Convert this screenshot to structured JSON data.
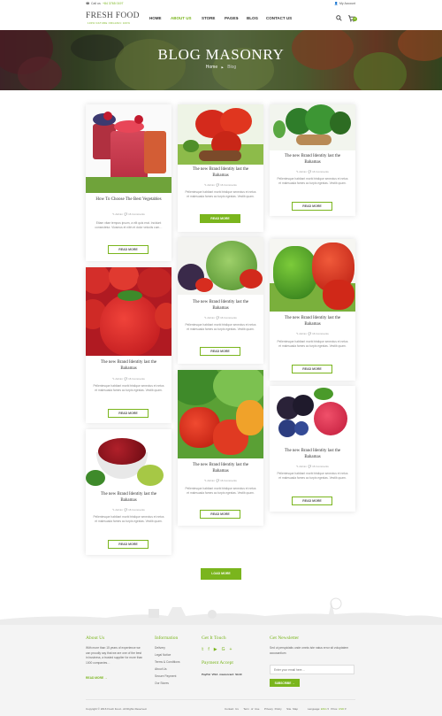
{
  "topbar": {
    "call": "Call us",
    "phone": "+84 3765 0197",
    "account": "My Account"
  },
  "header": {
    "logo": "FRESH FOOD",
    "tagline": "100% NATURE ORGANIC 100%",
    "nav": [
      "HOME",
      "ABOUT US",
      "STORE",
      "PAGES",
      "BLOG",
      "CONTACT US"
    ],
    "cart_count": "0"
  },
  "hero": {
    "title": "BLOG MASONRY",
    "crumb_home": "Home",
    "crumb_sep": "▶",
    "crumb_current": "Blog"
  },
  "cards": [
    {
      "title": "How To Choose The Best Vegetables",
      "author": "Admin",
      "comments": "16 Comments",
      "excerpt": "Etiam vitae tempus ipsum, a elit quis erat. Incidunt consectetur. Vivamus et nibh et dolor velociis cum…",
      "btn": "READ MORE"
    },
    {
      "title": "The new Brand Identity last the Bahamas",
      "author": "Admin",
      "comments": "16 Comments",
      "excerpt": "Pellentesque habitant morbi tristique senectus et netus et malesuada fames ac turpis egestas. Vestib quam.",
      "btn": "READ MORE"
    },
    {
      "title": "The new Brand Identity last the Bahamas",
      "author": "Admin",
      "comments": "16 Comments",
      "excerpt": "Pellentesque habitant morbi tristique senectus et netus et malesuada fames ac turpis egestas. Vestib quam.",
      "btn": "READ MORE"
    },
    {
      "title": "The new Brand Identity last the Bahamas",
      "author": "Admin",
      "comments": "16 Comments",
      "excerpt": "Pellentesque habitant morbi tristique senectus et netus et malesuada fames ac turpis egestas. Vestib quam.",
      "btn": "READ MORE"
    },
    {
      "title": "The new Brand Identity last the Bahamas",
      "author": "Admin",
      "comments": "16 Comments",
      "excerpt": "Pellentesque habitant morbi tristique senectus et netus et malesuada fames ac turpis egestas. Vestib quam.",
      "btn": "READ MORE"
    },
    {
      "title": "The new Brand Identity last the Bahamas",
      "author": "Admin",
      "comments": "16 Comments",
      "excerpt": "Pellentesque habitant morbi tristique senectus et netus et malesuada fames ac turpis egestas. Vestib quam.",
      "btn": "READ MORE"
    },
    {
      "title": "The new Brand Identity last the Bahamas",
      "author": "Admin",
      "comments": "16 Comments",
      "excerpt": "Pellentesque habitant morbi tristique senectus et netus et malesuada fames ac turpis egestas. Vestib quam.",
      "btn": "READ MORE"
    },
    {
      "title": "The new Brand Identity last the Bahamas",
      "author": "Admin",
      "comments": "16 Comments",
      "excerpt": "Pellentesque habitant morbi tristique senectus et netus et malesuada fames ac turpis egestas. Vestib quam.",
      "btn": "READ MORE"
    },
    {
      "title": "The new Brand Identity last the Bahamas",
      "author": "Admin",
      "comments": "16 Comments",
      "excerpt": "Pellentesque habitant morbi tristique senectus et netus et malesuada fames ac turpis egestas. Vestib quam.",
      "btn": "READ MORE"
    }
  ],
  "load_more": "LOAD MORE",
  "footer": {
    "about": {
      "title": "About Us",
      "text": "With more than 15 years of experience we can proudly say that we are one of the best in business, a trusted supplier for more than 1000 companies…",
      "link": "READ MORE"
    },
    "information": {
      "title": "Information",
      "links": [
        "Delivery",
        "Legal Notice",
        "Terms & Conditions",
        "About Us",
        "Secure Payment",
        "Our Stores"
      ]
    },
    "touch": {
      "title": "Get It Touch",
      "payment": "Payment Accept",
      "cards": [
        "PayPal",
        "VISA",
        "mastercard",
        "Skrill"
      ]
    },
    "newsletter": {
      "title": "Get Newsletter",
      "text": "Sed ut perspiciatis unde omnis iste natus error sit voluptatem accusantium",
      "placeholder": "Enter your email here…",
      "btn": "SUBSCRIBE"
    },
    "copyright": "Copyright © 2016 Fresh Food - All Rights Reserved.",
    "links": [
      "Contact Us",
      "Term of Use",
      "Privacy Policy",
      "Site Map"
    ],
    "language_label": "Language:",
    "language": "ENG",
    "price_label": "Price:",
    "price": "USD"
  },
  "colors": {
    "accent": "#7ab51d"
  }
}
